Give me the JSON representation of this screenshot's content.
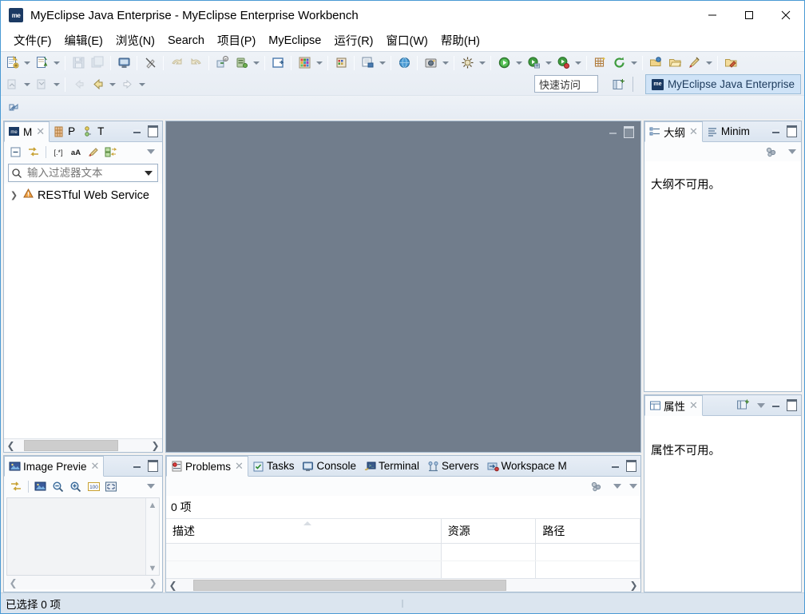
{
  "window": {
    "title": "MyEclipse Java Enterprise - MyEclipse Enterprise Workbench",
    "app_icon_label": "me",
    "minimize_label": "最小化",
    "maximize_label": "最大化",
    "close_label": "关闭"
  },
  "menubar": {
    "items": [
      {
        "label": "文件(F)"
      },
      {
        "label": "编辑(E)"
      },
      {
        "label": "浏览(N)"
      },
      {
        "label": "Search"
      },
      {
        "label": "项目(P)"
      },
      {
        "label": "MyEclipse"
      },
      {
        "label": "运行(R)"
      },
      {
        "label": "窗口(W)"
      },
      {
        "label": "帮助(H)"
      }
    ]
  },
  "toolbar": {
    "quick_access": {
      "placeholder": "快速访问",
      "value": ""
    },
    "perspective_open_label": "打开透视图",
    "perspective_active": {
      "label": "MyEclipse Java Enterprise",
      "icon_label": "me"
    },
    "buttons": [
      {
        "name": "new-wizard",
        "icon": "new-file-icon"
      },
      {
        "name": "new-dropdown",
        "icon": "chevron-down-icon"
      },
      {
        "name": "new-project",
        "icon": "new-project-icon"
      },
      {
        "name": "new-project-dropdown",
        "icon": "chevron-down-icon"
      },
      {
        "name": "save",
        "icon": "save-icon"
      },
      {
        "name": "save-all",
        "icon": "save-all-icon"
      },
      {
        "name": "print",
        "icon": "print-icon"
      },
      {
        "name": "toggle-markers",
        "icon": "marker-icon"
      },
      {
        "name": "undo",
        "icon": "undo-icon"
      },
      {
        "name": "redo",
        "icon": "redo-icon"
      },
      {
        "name": "deploy",
        "icon": "deploy-icon"
      },
      {
        "name": "servers",
        "icon": "server-icon"
      },
      {
        "name": "servers-dropdown",
        "icon": "chevron-down-icon"
      },
      {
        "name": "open-type",
        "icon": "open-type-icon"
      },
      {
        "name": "perspective-grid",
        "icon": "grid-icon"
      },
      {
        "name": "perspective-grid-dropdown",
        "icon": "chevron-down-icon"
      },
      {
        "name": "database-explorer",
        "icon": "database-icon"
      },
      {
        "name": "web-browser",
        "icon": "browser-icon"
      },
      {
        "name": "browser-dropdown",
        "icon": "chevron-down-icon"
      },
      {
        "name": "globe",
        "icon": "globe-icon"
      },
      {
        "name": "snapshot",
        "icon": "camera-icon"
      },
      {
        "name": "snapshot-dropdown",
        "icon": "chevron-down-icon"
      },
      {
        "name": "debug",
        "icon": "bug-icon"
      },
      {
        "name": "debug-dropdown",
        "icon": "chevron-down-icon"
      },
      {
        "name": "run",
        "icon": "run-icon"
      },
      {
        "name": "run-dropdown",
        "icon": "chevron-down-icon"
      },
      {
        "name": "run-external",
        "icon": "run-external-icon"
      },
      {
        "name": "run-external-dropdown",
        "icon": "chevron-down-icon"
      },
      {
        "name": "run-server",
        "icon": "run-server-icon"
      },
      {
        "name": "run-server-dropdown",
        "icon": "chevron-down-icon"
      },
      {
        "name": "new-package",
        "icon": "package-icon"
      },
      {
        "name": "refresh",
        "icon": "refresh-icon"
      },
      {
        "name": "refresh-dropdown",
        "icon": "chevron-down-icon"
      },
      {
        "name": "open-folder",
        "icon": "open-folder-icon"
      },
      {
        "name": "folder",
        "icon": "folder-icon"
      },
      {
        "name": "paint",
        "icon": "paint-icon"
      },
      {
        "name": "paint-dropdown",
        "icon": "chevron-down-icon"
      },
      {
        "name": "folder-edit",
        "icon": "folder-edit-icon"
      }
    ],
    "row2_buttons": [
      {
        "name": "previous-annotation",
        "icon": "prev-annotation-icon"
      },
      {
        "name": "previous-annotation-dropdown",
        "icon": "chevron-down-icon"
      },
      {
        "name": "next-annotation",
        "icon": "next-annotation-icon"
      },
      {
        "name": "next-annotation-dropdown",
        "icon": "chevron-down-icon"
      },
      {
        "name": "back-disabled",
        "icon": "back-arrow-icon"
      },
      {
        "name": "back",
        "icon": "back-arrow-icon"
      },
      {
        "name": "back-dropdown",
        "icon": "chevron-down-icon"
      },
      {
        "name": "forward",
        "icon": "forward-arrow-icon"
      },
      {
        "name": "forward-dropdown",
        "icon": "chevron-down-icon"
      }
    ],
    "coolbar2_buttons": [
      {
        "name": "open-perspective-dialog",
        "icon": "perspective-icon"
      }
    ]
  },
  "explorer": {
    "tabs": [
      {
        "label": "M",
        "icon": "myeclipse-explorer-icon",
        "active": true,
        "closable": true
      },
      {
        "label": "P",
        "icon": "package-explorer-icon",
        "active": false,
        "closable": false
      },
      {
        "label": "T",
        "icon": "type-hierarchy-icon",
        "active": false,
        "closable": false
      }
    ],
    "toolbar": [
      {
        "name": "collapse-all",
        "icon": "collapse-all-icon"
      },
      {
        "name": "link-with-editor",
        "icon": "link-editor-icon"
      },
      {
        "name": "regex-filter",
        "icon": "regex-icon"
      },
      {
        "name": "case-sensitive",
        "icon": "case-sensitive-icon"
      },
      {
        "name": "filter-rocket",
        "icon": "rocket-icon"
      },
      {
        "name": "sort-order",
        "icon": "sort-icon"
      }
    ],
    "filter": {
      "placeholder": "输入过滤器文本",
      "value": ""
    },
    "tree": [
      {
        "label": "RESTful Web Service",
        "icon": "restful-service-icon",
        "expanded": false
      }
    ],
    "hscroll": {
      "thumb_left_pct": 5,
      "thumb_width_pct": 72
    }
  },
  "image_preview": {
    "tabs": [
      {
        "label": "Image Previe",
        "icon": "image-preview-icon",
        "active": true,
        "closable": true
      }
    ],
    "toolbar": [
      {
        "name": "link-with-editor",
        "icon": "link-editor-icon"
      },
      {
        "name": "original-image",
        "icon": "image-icon"
      },
      {
        "name": "zoom-out",
        "icon": "zoom-out-icon"
      },
      {
        "name": "zoom-in",
        "icon": "zoom-in-icon"
      },
      {
        "name": "zoom-100",
        "icon": "zoom-100-icon"
      },
      {
        "name": "fit-to-window",
        "icon": "fit-window-icon"
      }
    ]
  },
  "editor": {
    "background_color": "#717d8c",
    "minimize_label": "最小化",
    "maximize_label": "最大化"
  },
  "outline": {
    "tabs": [
      {
        "label": "大纲",
        "icon": "outline-icon",
        "active": true,
        "closable": true
      },
      {
        "label": "Minim",
        "icon": "minimap-icon",
        "active": false,
        "closable": false
      }
    ],
    "toolbar": [
      {
        "name": "outline-settings",
        "icon": "settings-icon"
      }
    ],
    "message": "大纲不可用。"
  },
  "properties": {
    "tabs": [
      {
        "label": "属性",
        "icon": "properties-icon",
        "active": true,
        "closable": true
      }
    ],
    "toolbar": [
      {
        "name": "pin-properties",
        "icon": "pin-icon"
      }
    ],
    "message": "属性不可用。"
  },
  "bottom_panel": {
    "tabs": [
      {
        "label": "Problems",
        "icon": "problems-icon",
        "active": true,
        "closable": true
      },
      {
        "label": "Tasks",
        "icon": "tasks-icon",
        "active": false,
        "closable": false
      },
      {
        "label": "Console",
        "icon": "console-icon",
        "active": false,
        "closable": false
      },
      {
        "label": "Terminal",
        "icon": "terminal-icon",
        "active": false,
        "closable": false
      },
      {
        "label": "Servers",
        "icon": "servers-icon",
        "active": false,
        "closable": false
      },
      {
        "label": "Workspace M",
        "icon": "workspace-migration-icon",
        "active": false,
        "closable": false
      }
    ],
    "toolbar": [
      {
        "name": "problems-settings",
        "icon": "settings-icon"
      }
    ],
    "count_label": "0 项",
    "columns": [
      {
        "label": "描述",
        "sorted": true
      },
      {
        "label": "资源",
        "sorted": false
      },
      {
        "label": "路径",
        "sorted": false
      }
    ],
    "rows": [],
    "hscroll": {
      "thumb_left_pct": 3,
      "thumb_width_pct": 70
    }
  },
  "statusbar": {
    "message": "已选择 0 项"
  },
  "colors": {
    "accent": "#4a9ad4",
    "editor_bg": "#717d8c",
    "tab_active_bg": "#fbfcfd",
    "statusbar_bg": "#dbe5ef",
    "perspective_active_bg": "#cfe3f7"
  }
}
